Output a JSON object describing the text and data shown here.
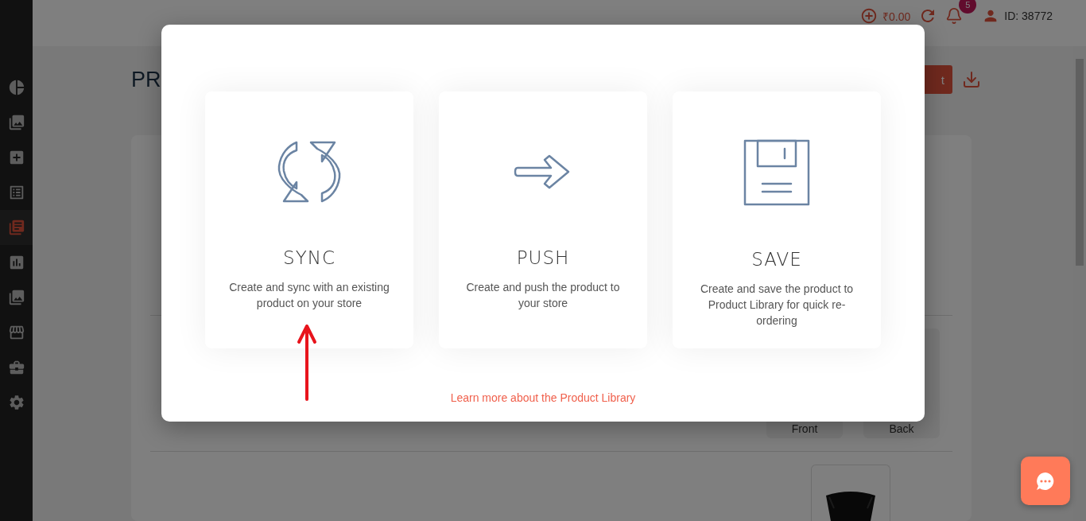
{
  "sidebar": {
    "items": [
      {
        "kind": "pie",
        "selected": false
      },
      {
        "kind": "gallery",
        "selected": false
      },
      {
        "kind": "add",
        "selected": false
      },
      {
        "kind": "list",
        "selected": false
      },
      {
        "kind": "library",
        "selected": true
      },
      {
        "kind": "chart",
        "selected": false
      },
      {
        "kind": "gallery",
        "selected": false
      },
      {
        "kind": "store",
        "selected": false
      },
      {
        "kind": "briefcase",
        "selected": false
      },
      {
        "kind": "settings",
        "selected": false
      }
    ]
  },
  "header": {
    "balance": "₹0.00",
    "notifications": "5",
    "user_id": "ID: 38772"
  },
  "page": {
    "title": "PR",
    "action_button": "t",
    "preview_labels": [
      "Front",
      "Back"
    ]
  },
  "modal": {
    "options": [
      {
        "kind": "sync",
        "title": "SYNC",
        "description": "Create and sync with an existing product on your store"
      },
      {
        "kind": "push",
        "title": "PUSH",
        "description": "Create and push the product to your store"
      },
      {
        "kind": "save",
        "title": "SAVE",
        "description": "Create and save the product to Product Library for quick re-ordering"
      }
    ],
    "link": "Learn more about the Product Library"
  }
}
